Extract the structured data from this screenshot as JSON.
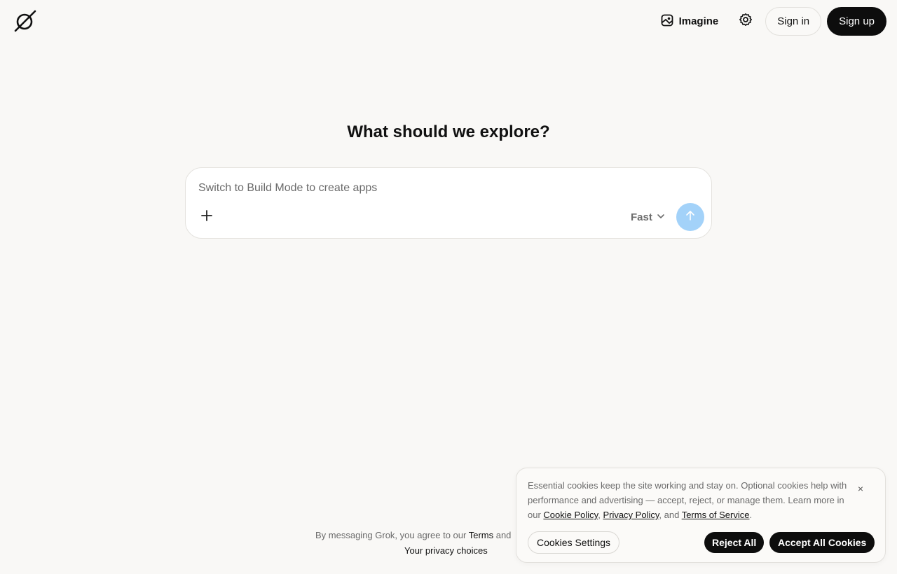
{
  "header": {
    "logo_icon": "grok-logo-icon",
    "imagine_label": "Imagine",
    "imagine_icon": "image-icon",
    "settings_icon": "gear-icon",
    "signin_label": "Sign in",
    "signup_label": "Sign up"
  },
  "main": {
    "heading": "What should we explore?",
    "composer": {
      "placeholder": "Switch to Build Mode to create apps",
      "attach_icon": "plus-icon",
      "model_label": "Fast",
      "model_icon": "chevron-down-icon",
      "send_icon": "arrow-up-icon",
      "send_color": "#a3d2f9"
    }
  },
  "footer": {
    "prefix": "By messaging Grok, you agree to our ",
    "terms_link": "Terms",
    "conjunction": " and",
    "privacy_choices": "Your privacy choices"
  },
  "cookie_banner": {
    "text_part1": "Essential cookies keep the site working and stay on. Optional cookies help with performance and advertising — accept, reject, or manage them. Learn more in our ",
    "cookie_policy_link": "Cookie Policy",
    "comma1": ", ",
    "privacy_policy_link": "Privacy Policy",
    "and_text": ", and ",
    "terms_of_service_link": "Terms of Service",
    "period": ".",
    "close_label": "×",
    "settings_label": "Cookies Settings",
    "reject_label": "Reject All",
    "accept_label": "Accept All Cookies"
  },
  "colors": {
    "background": "#f9f8f6",
    "primary_button": "#0d0d0d",
    "send_button": "#a3d2f9"
  }
}
